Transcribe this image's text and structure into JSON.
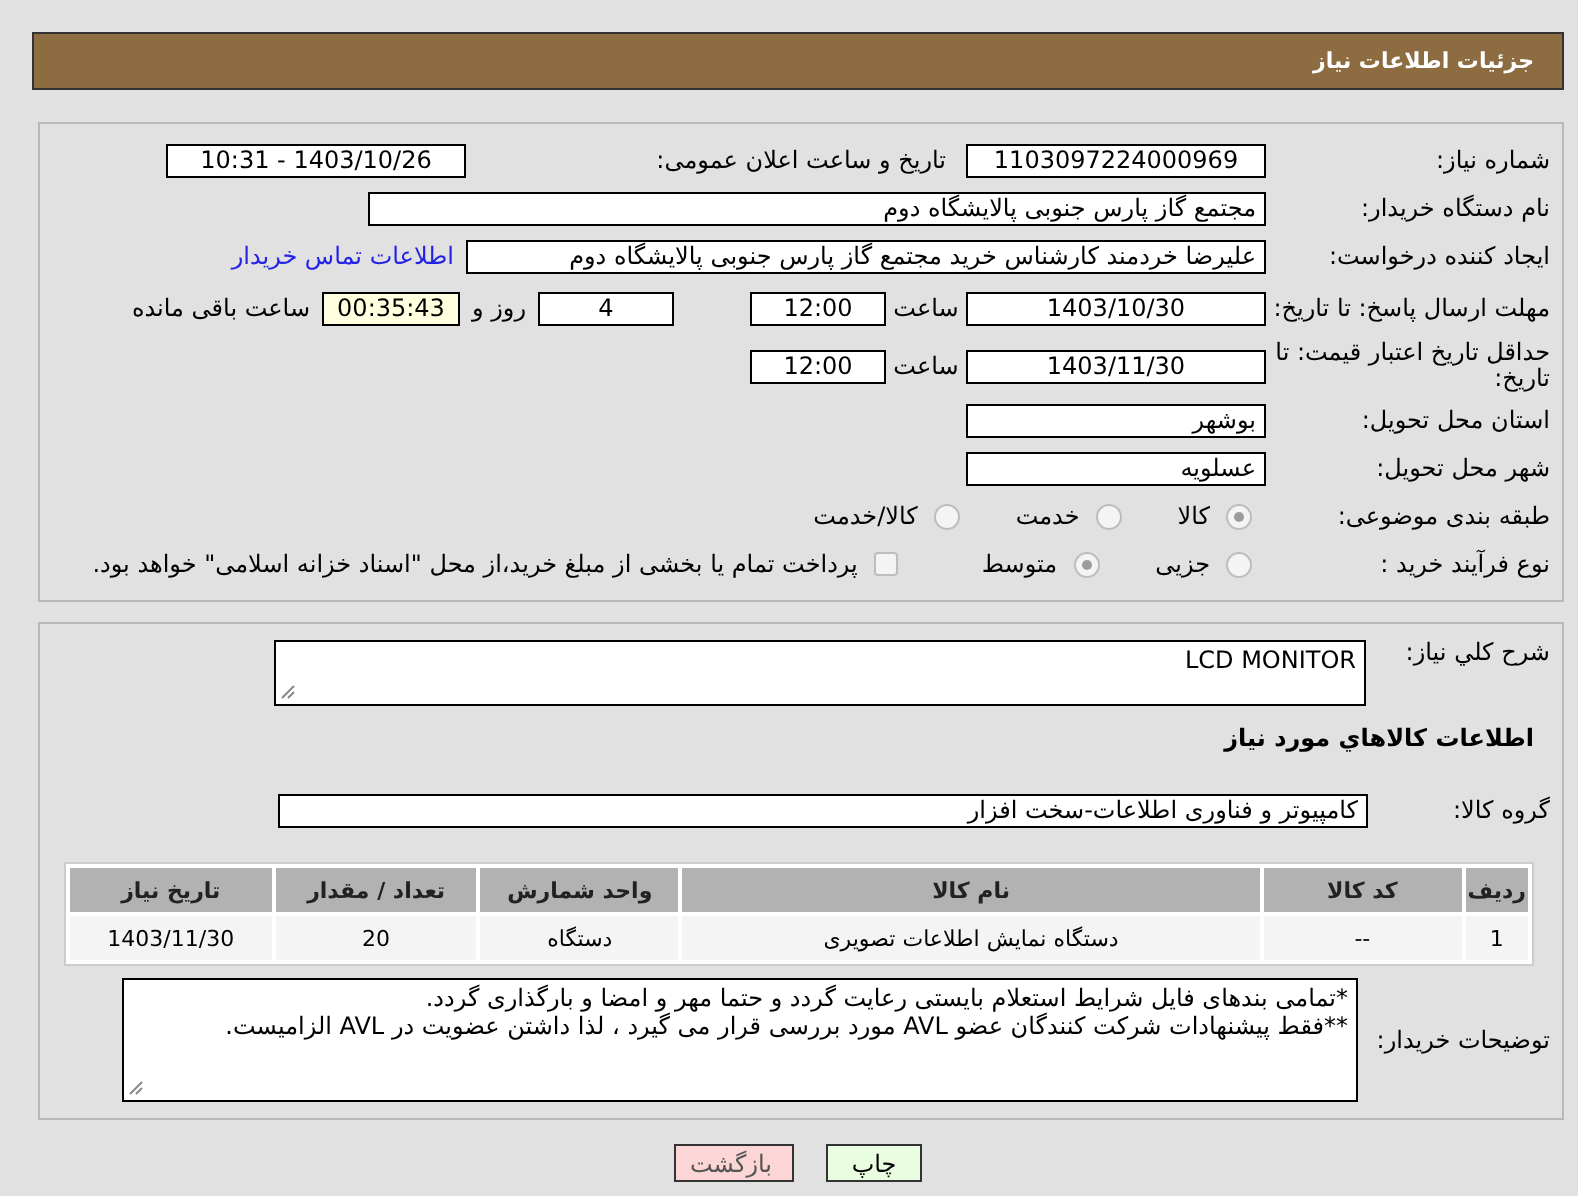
{
  "header": {
    "title": "جزئیات اطلاعات نیاز"
  },
  "need_number": {
    "label": "شماره نیاز:",
    "value": "1103097224000969"
  },
  "announce": {
    "label": "تاریخ و ساعت اعلان عمومی:",
    "value": "1403/10/26 - 10:31"
  },
  "buyer": {
    "label": "نام دستگاه خریدار:",
    "value": "مجتمع گاز پارس جنوبی  پالایشگاه دوم"
  },
  "requester": {
    "label": "ایجاد کننده درخواست:",
    "value": "علیرضا خردمند کارشناس خرید مجتمع گاز پارس جنوبی  پالایشگاه دوم",
    "link": "اطلاعات تماس خریدار"
  },
  "response_deadline": {
    "label": "مهلت ارسال پاسخ: تا تاریخ:",
    "date": "1403/10/30",
    "time_label": "ساعت",
    "time": "12:00",
    "days": "4",
    "days_label": "روز و",
    "remaining": "00:35:43",
    "remaining_label": "ساعت باقی مانده"
  },
  "price_validity": {
    "label": "حداقل تاریخ اعتبار قیمت: تا تاریخ:",
    "date": "1403/11/30",
    "time_label": "ساعت",
    "time": "12:00"
  },
  "province": {
    "label": "استان محل تحویل:",
    "value": "بوشهر"
  },
  "city": {
    "label": "شهر محل تحویل:",
    "value": "عسلویه"
  },
  "category": {
    "label": "طبقه بندی موضوعی:",
    "options": [
      {
        "label": "کالا",
        "selected": true
      },
      {
        "label": "خدمت",
        "selected": false
      },
      {
        "label": "کالا/خدمت",
        "selected": false
      }
    ]
  },
  "purchase_type": {
    "label": "نوع فرآیند خرید :",
    "options": [
      {
        "label": "جزیی",
        "selected": false
      },
      {
        "label": "متوسط",
        "selected": true
      }
    ],
    "payment_check": {
      "checked": false,
      "label": "پرداخت تمام یا بخشی از مبلغ خرید،از محل \"اسناد خزانه اسلامی\" خواهد بود."
    }
  },
  "description": {
    "label": "شرح کلي نياز:",
    "value": "LCD MONITOR"
  },
  "goods_title": "اطلاعات کالاهاي مورد نياز",
  "goods_group": {
    "label": "گروه کالا:",
    "value": "کامپیوتر و فناوری اطلاعات-سخت افزار"
  },
  "table": {
    "columns": [
      "ردیف",
      "کد کالا",
      "نام کالا",
      "واحد شمارش",
      "تعداد / مقدار",
      "تاریخ نیاز"
    ],
    "rows": [
      [
        "1",
        "--",
        "دستگاه نمایش اطلاعات تصویری",
        "دستگاه",
        "20",
        "1403/11/30"
      ]
    ]
  },
  "buyer_notes": {
    "label": "توضیحات خریدار:",
    "lines": [
      "*تمامی بندهای فایل شرایط استعلام بایستی رعایت گردد و حتما مهر و امضا و بارگذاری گردد.",
      "**فقط پیشنهادات شرکت کنندگان عضو AVL مورد بررسی قرار می گیرد ، لذا داشتن عضویت در AVL الزامیست."
    ]
  },
  "buttons": [
    {
      "kind": "print",
      "label": "چاپ"
    },
    {
      "kind": "back",
      "label": "بازگشت"
    }
  ]
}
